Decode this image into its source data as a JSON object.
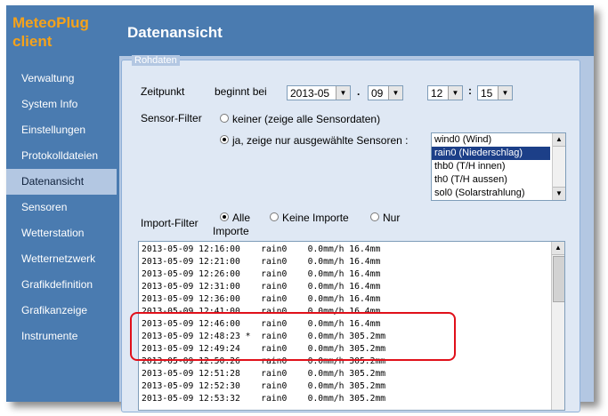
{
  "app": {
    "name_line1": "MeteoPlug",
    "name_line2": "client",
    "brand_color": "#f5a21a",
    "primary_color": "#4a7bb0"
  },
  "sidebar": {
    "items": [
      {
        "label": "Verwaltung"
      },
      {
        "label": "System Info"
      },
      {
        "label": "Einstellungen"
      },
      {
        "label": "Protokolldateien"
      },
      {
        "label": "Datenansicht",
        "active": true
      },
      {
        "label": "Sensoren"
      },
      {
        "label": "Wetterstation"
      },
      {
        "label": "Wetternetzwerk"
      },
      {
        "label": "Grafikdefinition"
      },
      {
        "label": "Grafikanzeige"
      },
      {
        "label": "Instrumente"
      }
    ]
  },
  "header": {
    "title": "Datenansicht"
  },
  "rohdaten": {
    "legend": "Rohdaten",
    "zeitpunkt": {
      "label": "Zeitpunkt",
      "sublabel": "beginnt bei",
      "month": "2013-05",
      "sep_dot": ".",
      "day": "09",
      "hour": "12",
      "sep_colon": ":",
      "minute": "15"
    },
    "sensor_filter": {
      "label": "Sensor-Filter",
      "option_none": "keiner (zeige alle Sensordaten)",
      "option_selected": "ja, zeige nur ausgewählte Sensoren :",
      "checked": "selected",
      "sensors": [
        {
          "label": "wind0 (Wind)"
        },
        {
          "label": "rain0 (Niederschlag)",
          "selected": true
        },
        {
          "label": "thb0 (T/H innen)"
        },
        {
          "label": "th0 (T/H aussen)"
        },
        {
          "label": "sol0 (Solarstrahlung)"
        }
      ]
    },
    "import_filter": {
      "label": "Import-Filter",
      "option_all_line1": "Alle",
      "option_all_line2": "Importe",
      "option_none": "Keine Importe",
      "option_only": "Nur",
      "checked": "all"
    },
    "data_lines": [
      "2013-05-09 12:16:00    rain0    0.0mm/h 16.4mm",
      "2013-05-09 12:21:00    rain0    0.0mm/h 16.4mm",
      "2013-05-09 12:26:00    rain0    0.0mm/h 16.4mm",
      "2013-05-09 12:31:00    rain0    0.0mm/h 16.4mm",
      "2013-05-09 12:36:00    rain0    0.0mm/h 16.4mm",
      "2013-05-09 12:41:00    rain0    0.0mm/h 16.4mm",
      "2013-05-09 12:46:00    rain0    0.0mm/h 16.4mm",
      "2013-05-09 12:48:23 *  rain0    0.0mm/h 305.2mm",
      "2013-05-09 12:49:24    rain0    0.0mm/h 305.2mm",
      "2013-05-09 12:50:26    rain0    0.0mm/h 305.2mm",
      "2013-05-09 12:51:28    rain0    0.0mm/h 305.2mm",
      "2013-05-09 12:52:30    rain0    0.0mm/h 305.2mm",
      "2013-05-09 12:53:32    rain0    0.0mm/h 305.2mm"
    ],
    "highlight_color": "#e0101a"
  }
}
